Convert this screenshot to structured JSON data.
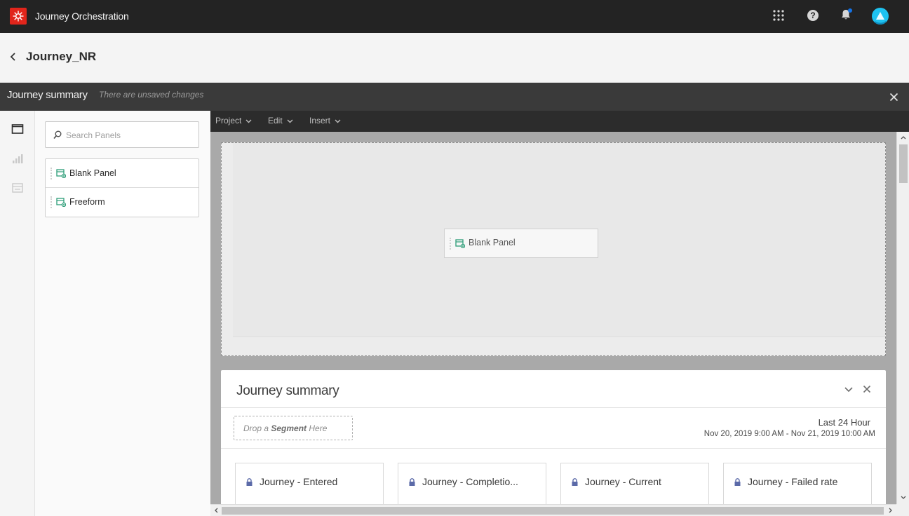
{
  "app": {
    "title": "Journey Orchestration"
  },
  "topbar": {
    "icons": [
      "apps-grid-icon",
      "help-icon",
      "notification-bell-icon",
      "user-avatar"
    ]
  },
  "journey": {
    "name": "Journey_NR"
  },
  "summary_bar": {
    "title": "Journey summary",
    "status": "There are unsaved changes"
  },
  "rail": {
    "icons": [
      "panels-icon",
      "visualizations-icon",
      "components-icon"
    ]
  },
  "panels": {
    "search_placeholder": "Search Panels",
    "items": [
      {
        "label": "Blank Panel"
      },
      {
        "label": "Freeform"
      }
    ]
  },
  "menubar": {
    "items": [
      {
        "label": "Project"
      },
      {
        "label": "Edit"
      },
      {
        "label": "Insert"
      }
    ]
  },
  "canvas": {
    "ghost_panel_label": "Blank Panel",
    "summary_panel": {
      "title": "Journey summary",
      "segment_drop_prefix": "Drop a ",
      "segment_drop_bold": "Segment",
      "segment_drop_suffix": " Here",
      "range_label": "Last 24 Hour",
      "range_dates": "Nov 20, 2019 9:00 AM - Nov 21, 2019 10:00 AM",
      "metrics": [
        {
          "label": "Journey - Entered"
        },
        {
          "label": "Journey - Completio..."
        },
        {
          "label": "Journey - Current"
        },
        {
          "label": "Journey - Failed rate"
        }
      ]
    }
  },
  "colors": {
    "topbar": "#232323",
    "brand": "#e1251b",
    "accent": "#1473e6",
    "avatar": "#1ec2f0",
    "panel_icon": "#2d9d78"
  }
}
